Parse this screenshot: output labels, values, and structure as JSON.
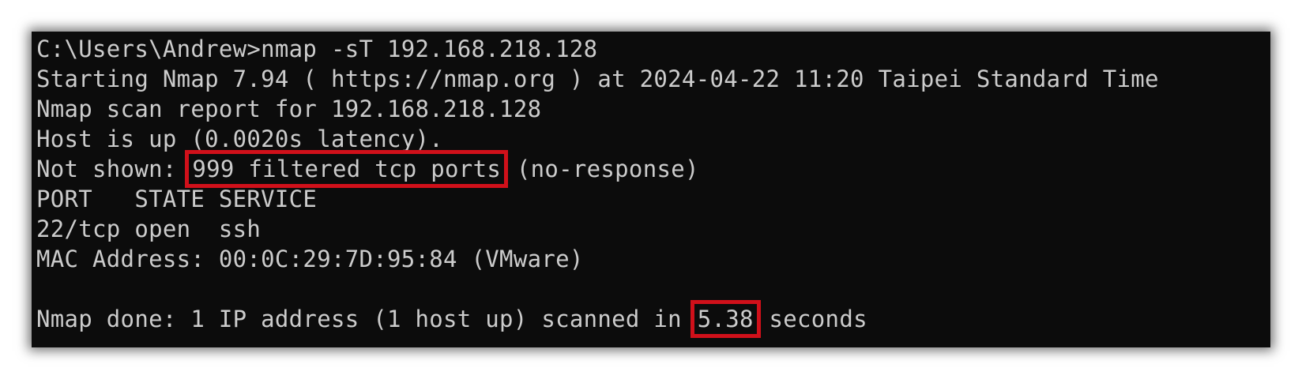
{
  "terminal": {
    "lines": {
      "cmd": "C:\\Users\\Andrew>nmap -sT 192.168.218.128",
      "start": "Starting Nmap 7.94 ( https://nmap.org ) at 2024-04-22 11:20 Taipei Standard Time",
      "report": "Nmap scan report for 192.168.218.128",
      "host_up": "Host is up (0.0020s latency).",
      "not_shown_prefix": "Not shown:",
      "not_shown_highlight": "999 filtered tcp ports",
      "not_shown_suffix": "(no-response)",
      "header": "PORT   STATE SERVICE",
      "port_row": "22/tcp open  ssh",
      "mac": "MAC Address: 00:0C:29:7D:95:84 (VMware)",
      "done_prefix": "Nmap done: 1 IP address (1 host up) scanned in",
      "done_highlight": "5.38",
      "done_suffix": "seconds"
    },
    "highlight_color": "#d0101a",
    "background_color": "#0c0c0c",
    "text_color": "#cccccc"
  }
}
